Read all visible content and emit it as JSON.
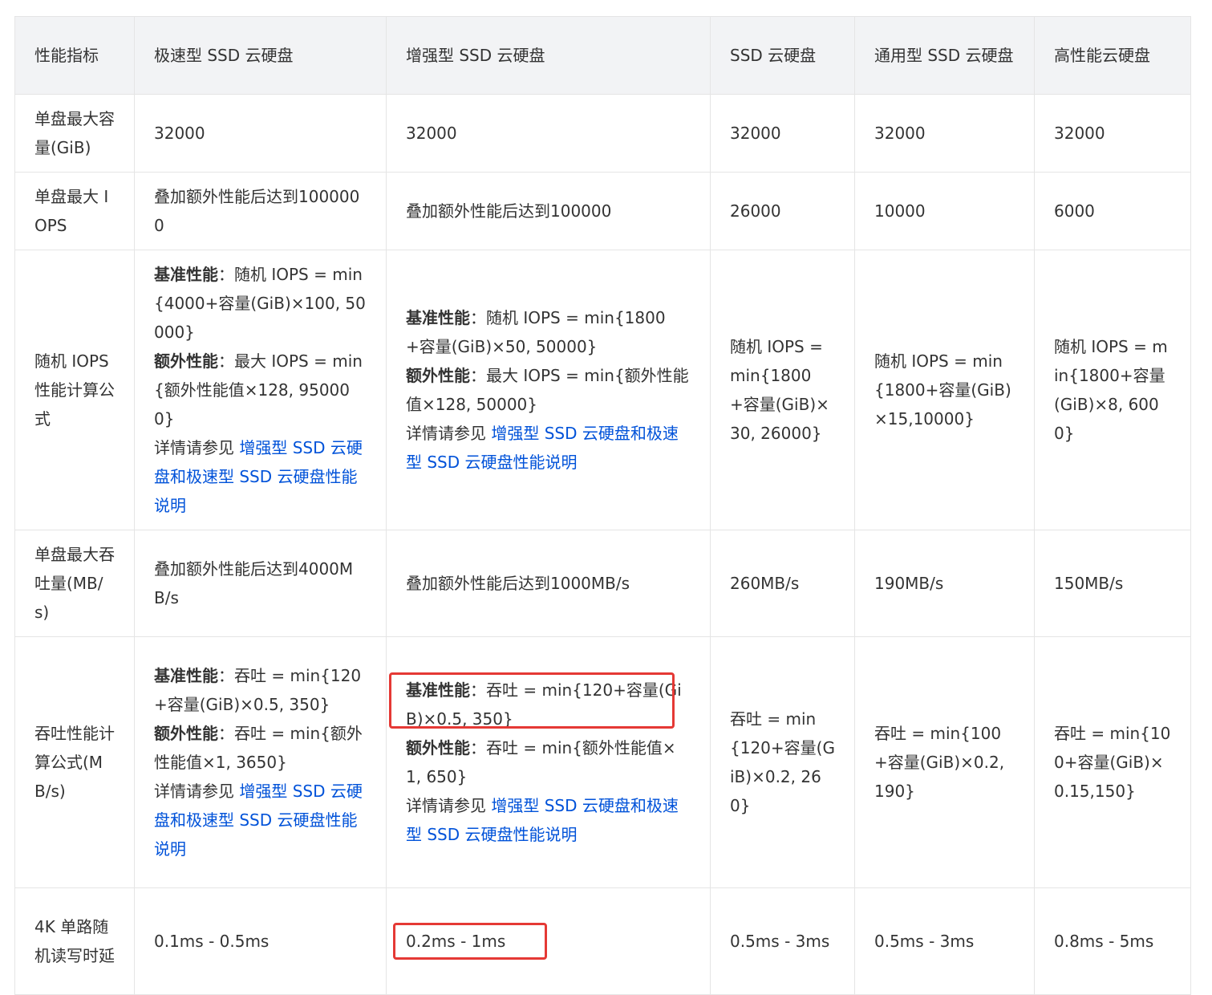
{
  "header": [
    "性能指标",
    "极速型 SSD 云硬盘",
    "增强型 SSD 云硬盘",
    "SSD 云硬盘",
    "通用型 SSD 云硬盘",
    "高性能云硬盘"
  ],
  "rows": {
    "capacity": {
      "label": "单盘最大容量(GiB)",
      "cells": [
        "32000",
        "32000",
        "32000",
        "32000",
        "32000"
      ]
    },
    "iops": {
      "label": "单盘最大 IOPS",
      "cells": [
        "叠加额外性能后达到1000000",
        "叠加额外性能后达到100000",
        "26000",
        "10000",
        "6000"
      ]
    },
    "iops_formula": {
      "label": "随机 IOPS 性能计算公式",
      "extreme": {
        "base_label": "基准性能",
        "base_text": "：随机 IOPS = min{4000+容量(GiB)×100, 50000}",
        "extra_label": "额外性能",
        "extra_text": "：最大 IOPS = min{额外性能值×128, 950000}",
        "detail_prefix": "详情请参见 ",
        "link": "增强型 SSD 云硬盘和极速型 SSD 云硬盘性能说明"
      },
      "enhanced": {
        "base_label": "基准性能",
        "base_text": "：随机 IOPS = min{1800+容量(GiB)×50, 50000}",
        "extra_label": "额外性能",
        "extra_text": "：最大 IOPS = min{额外性能值×128, 50000}",
        "detail_prefix": "详情请参见 ",
        "link": "增强型 SSD 云硬盘和极速型 SSD 云硬盘性能说明"
      },
      "ssd": "随机 IOPS = min{1800+容量(GiB)×30, 26000}",
      "general": "随机 IOPS = min{1800+容量(GiB)×15,10000}",
      "premium": "随机 IOPS = min{1800+容量(GiB)×8, 6000}"
    },
    "throughput": {
      "label": "单盘最大吞吐量(MB/s)",
      "cells": [
        "叠加额外性能后达到4000MB/s",
        "叠加额外性能后达到1000MB/s",
        "260MB/s",
        "190MB/s",
        "150MB/s"
      ]
    },
    "throughput_formula": {
      "label": "吞吐性能计算公式(MB/s)",
      "extreme": {
        "base_label": "基准性能",
        "base_text": "：吞吐 = min{120+容量(GiB)×0.5, 350}",
        "extra_label": "额外性能",
        "extra_text": "：吞吐 = min{额外性能值×1, 3650}",
        "detail_prefix": "详情请参见 ",
        "link": "增强型 SSD 云硬盘和极速型 SSD 云硬盘性能说明"
      },
      "enhanced": {
        "base_label": "基准性能",
        "base_text": "：吞吐 = min{120+容量(GiB)×0.5, 350}",
        "extra_label": "额外性能",
        "extra_text": "：吞吐 = min{额外性能值×1, 650}",
        "detail_prefix": "详情请参见 ",
        "link": "增强型 SSD 云硬盘和极速型 SSD 云硬盘性能说明"
      },
      "ssd": "吞吐 = min{120+容量(GiB)×0.2, 260}",
      "general": "吞吐 = min{100+容量(GiB)×0.2, 190}",
      "premium": "吞吐 = min{100+容量(GiB)×0.15,150}"
    },
    "latency": {
      "label": "4K 单路随机读写时延",
      "cells": [
        "0.1ms - 0.5ms",
        "0.2ms - 1ms",
        "0.5ms - 3ms",
        "0.5ms - 3ms",
        "0.8ms - 5ms"
      ]
    }
  },
  "colors": {
    "highlight": "#e53935",
    "link": "#0052d9",
    "header_bg": "#f2f3f5",
    "border": "#e5e5e5"
  }
}
